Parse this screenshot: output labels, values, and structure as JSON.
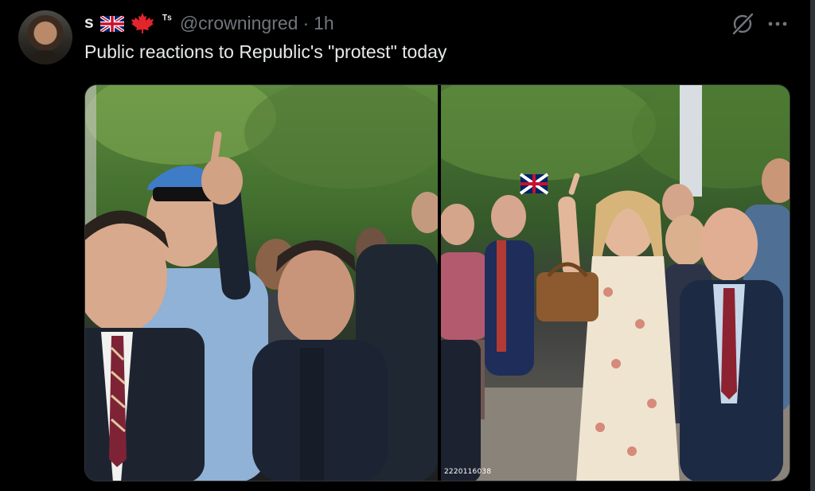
{
  "post": {
    "author": {
      "display_name": "s",
      "name_suffix": "ᵀˢ",
      "handle": "@crowningred",
      "flags": [
        "uk-flag",
        "canada-flag"
      ]
    },
    "separator": "·",
    "timestamp": "1h",
    "text": "Public reactions to Republic's \"protest\" today",
    "actions": {
      "grok_icon": "grok-icon",
      "more_icon": "more-options-icon"
    },
    "media": {
      "photo_count": 2,
      "right_photo_watermark": "2220116038"
    }
  },
  "colors": {
    "background": "#000000",
    "primary_text": "#e7e9ea",
    "secondary_text": "#71767b",
    "border": "#2f3336"
  }
}
